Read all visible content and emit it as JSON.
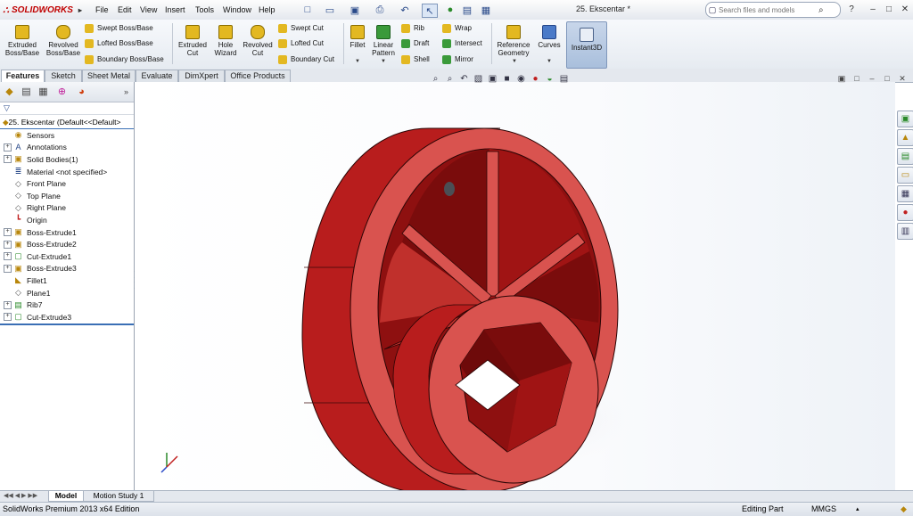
{
  "app": {
    "logo_text": "SOLIDWORKS",
    "document_title": "25. Ekscentar *"
  },
  "menu": [
    "File",
    "Edit",
    "View",
    "Insert",
    "Tools",
    "Window",
    "Help"
  ],
  "search": {
    "placeholder": "Search files and models"
  },
  "command_manager": {
    "extruded_boss": "Extruded Boss/Base",
    "revolved_boss": "Revolved Boss/Base",
    "swept_boss": "Swept Boss/Base",
    "lofted_boss": "Lofted Boss/Base",
    "boundary_boss": "Boundary Boss/Base",
    "extruded_cut": "Extruded Cut",
    "hole_wizard": "Hole Wizard",
    "revolved_cut": "Revolved Cut",
    "swept_cut": "Swept Cut",
    "lofted_cut": "Lofted Cut",
    "boundary_cut": "Boundary Cut",
    "fillet": "Fillet",
    "linear_pattern": "Linear Pattern",
    "rib": "Rib",
    "draft": "Draft",
    "shell": "Shell",
    "wrap": "Wrap",
    "intersect": "Intersect",
    "mirror": "Mirror",
    "reference_geometry": "Reference Geometry",
    "curves": "Curves",
    "instant3d": "Instant3D"
  },
  "tabs": [
    "Features",
    "Sketch",
    "Sheet Metal",
    "Evaluate",
    "DimXpert",
    "Office Products"
  ],
  "tree": {
    "root": "25. Ekscentar  (Default<<Default>",
    "items": [
      {
        "label": "Sensors",
        "icon": "sensors-icon",
        "expandable": false
      },
      {
        "label": "Annotations",
        "icon": "annotations-icon",
        "expandable": true
      },
      {
        "label": "Solid Bodies(1)",
        "icon": "solid-bodies-icon",
        "expandable": true
      },
      {
        "label": "Material <not specified>",
        "icon": "material-icon",
        "expandable": false
      },
      {
        "label": "Front Plane",
        "icon": "plane-icon",
        "expandable": false
      },
      {
        "label": "Top Plane",
        "icon": "plane-icon",
        "expandable": false
      },
      {
        "label": "Right Plane",
        "icon": "plane-icon",
        "expandable": false
      },
      {
        "label": "Origin",
        "icon": "origin-icon",
        "expandable": false
      },
      {
        "label": "Boss-Extrude1",
        "icon": "extrude-icon",
        "expandable": true
      },
      {
        "label": "Boss-Extrude2",
        "icon": "extrude-icon",
        "expandable": true
      },
      {
        "label": "Cut-Extrude1",
        "icon": "cut-icon",
        "expandable": true
      },
      {
        "label": "Boss-Extrude3",
        "icon": "extrude-icon",
        "expandable": true
      },
      {
        "label": "Fillet1",
        "icon": "fillet-icon",
        "expandable": false
      },
      {
        "label": "Plane1",
        "icon": "plane-icon",
        "expandable": false
      },
      {
        "label": "Rib7",
        "icon": "rib-icon",
        "expandable": true
      },
      {
        "label": "Cut-Extrude3",
        "icon": "cut-icon",
        "expandable": true
      }
    ]
  },
  "bottom_tabs": [
    "Model",
    "Motion Study 1"
  ],
  "status": {
    "edition": "SolidWorks Premium 2013 x64 Edition",
    "mode": "Editing Part",
    "units": "MMGS"
  },
  "colors": {
    "part_face": "#d9534f",
    "part_dark": "#b81d1d",
    "part_deep": "#8e1010",
    "brand": "#c00000"
  }
}
